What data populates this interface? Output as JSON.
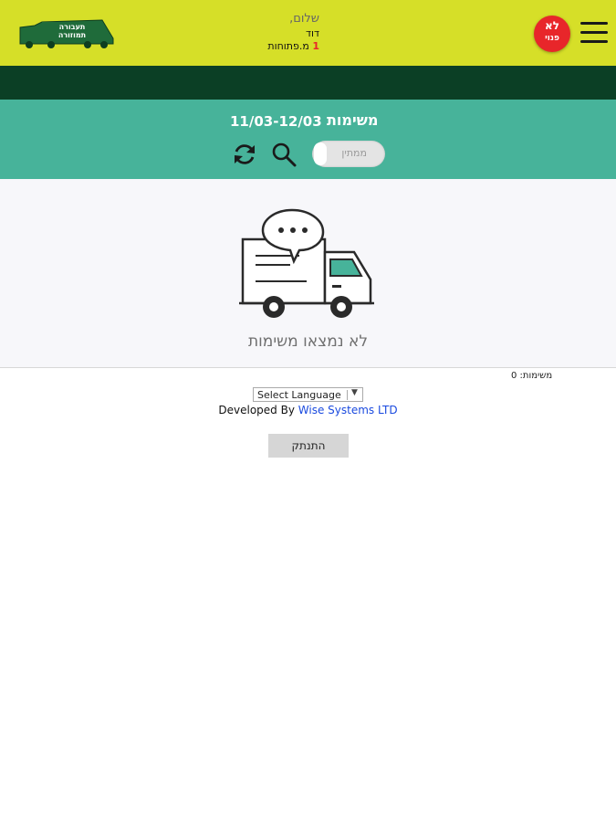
{
  "header": {
    "badge_line1": "לא",
    "badge_line2": "פנוי",
    "greeting": "שלום,",
    "user_name": "דוד",
    "open_count": "1",
    "open_label": "מ.פתוחות",
    "logo_text_top": "תעבורה",
    "logo_text_bottom": "תמוזורה"
  },
  "tasks": {
    "title": "משימות",
    "date_range": "11/03-12/03",
    "toggle_label": "ממתין",
    "empty_message": "לא נמצאו משימות",
    "count_label": "משימות: 0"
  },
  "footer": {
    "language_select": "Select Language",
    "developed_by": "Developed By",
    "company_link": "Wise Systems LTD",
    "logout_label": "התנתק"
  },
  "colors": {
    "header_bg": "#d6df28",
    "dark_bar": "#0b3f25",
    "teal_band": "#47b39a",
    "badge_red": "#e8262a",
    "link_blue": "#1a4adf"
  }
}
